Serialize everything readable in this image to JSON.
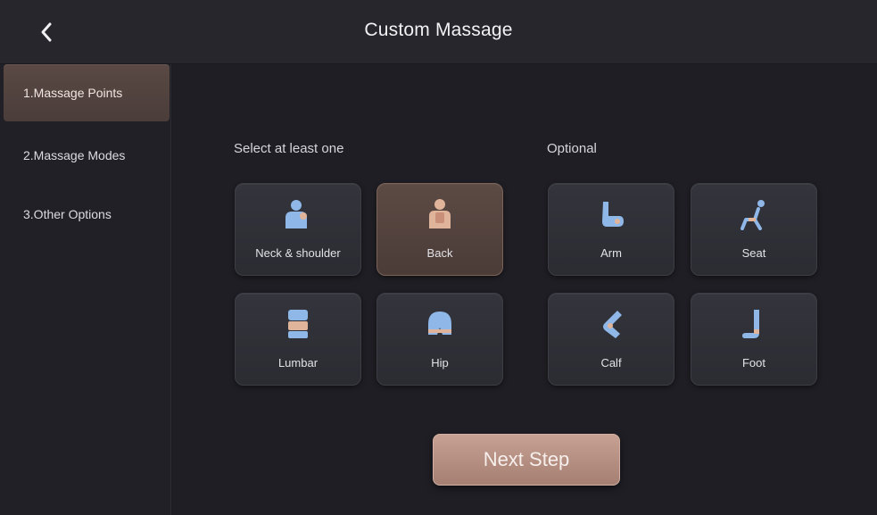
{
  "header": {
    "title": "Custom Massage",
    "back_icon": "chevron-left-icon"
  },
  "sidebar": {
    "items": [
      {
        "label": "1.Massage Points",
        "active": true
      },
      {
        "label": "2.Massage Modes",
        "active": false
      },
      {
        "label": "3.Other Options",
        "active": false
      }
    ]
  },
  "main": {
    "required_label": "Select at least one",
    "optional_label": "Optional",
    "required_parts": [
      {
        "label": "Neck & shoulder",
        "icon": "neck-shoulder-icon",
        "selected": false
      },
      {
        "label": "Back",
        "icon": "back-icon",
        "selected": true
      },
      {
        "label": "Lumbar",
        "icon": "lumbar-icon",
        "selected": false
      },
      {
        "label": "Hip",
        "icon": "hip-icon",
        "selected": false
      }
    ],
    "optional_parts": [
      {
        "label": "Arm",
        "icon": "arm-icon",
        "selected": false
      },
      {
        "label": "Seat",
        "icon": "seat-icon",
        "selected": false
      },
      {
        "label": "Calf",
        "icon": "calf-icon",
        "selected": false
      },
      {
        "label": "Foot",
        "icon": "foot-icon",
        "selected": false
      }
    ],
    "next_label": "Next Step"
  },
  "colors": {
    "accent": "#b48f82",
    "icon_blue": "#8fb8e8",
    "icon_skin": "#e0b49a"
  }
}
